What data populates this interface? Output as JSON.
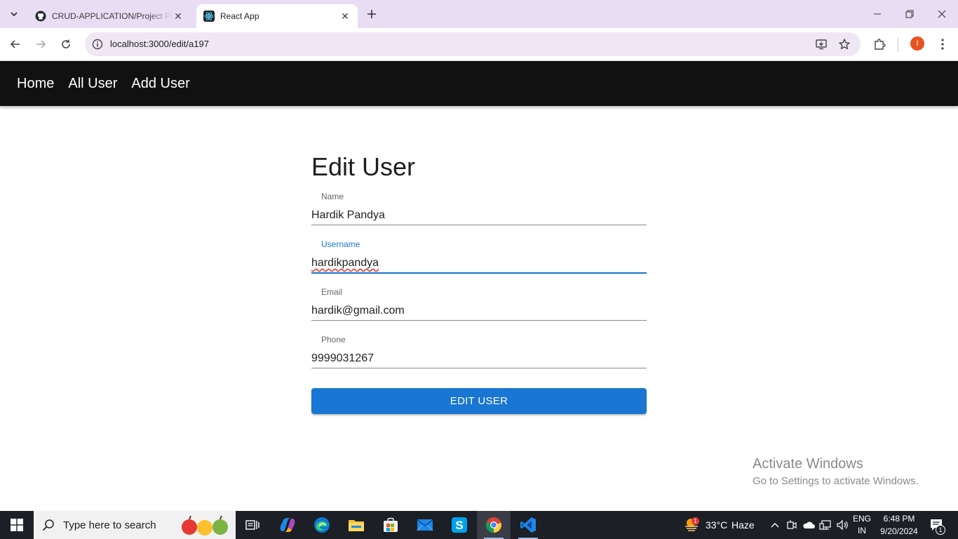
{
  "browser": {
    "tabs": [
      {
        "title": "CRUD-APPLICATION/Project Pr",
        "favicon": "github-icon",
        "active": false
      },
      {
        "title": "React App",
        "favicon": "react-icon",
        "active": true
      }
    ],
    "url": "localhost:3000/edit/a197",
    "profile_initial": "I",
    "profile_color": "#e8531f"
  },
  "nav": {
    "links": [
      "Home",
      "All User",
      "Add User"
    ],
    "background": "#111111"
  },
  "form": {
    "title": "Edit User",
    "fields": [
      {
        "label": "Name",
        "value": "Hardik Pandya",
        "focused": false
      },
      {
        "label": "Username",
        "value": "hardikpandya",
        "focused": true
      },
      {
        "label": "Email",
        "value": "hardik@gmail.com",
        "focused": false
      },
      {
        "label": "Phone",
        "value": "9999031267",
        "focused": false
      }
    ],
    "submit_label": "EDIT USER",
    "accent": "#1976d2"
  },
  "watermark": {
    "line1": "Activate Windows",
    "line2": "Go to Settings to activate Windows."
  },
  "taskbar": {
    "search_placeholder": "Type here to search",
    "weather_temp": "33°C",
    "weather_text": "Haze",
    "weather_badge": "1",
    "lang_line1": "ENG",
    "lang_line2": "IN",
    "time": "6:48 PM",
    "date": "9/20/2024",
    "notification_count": "1"
  }
}
